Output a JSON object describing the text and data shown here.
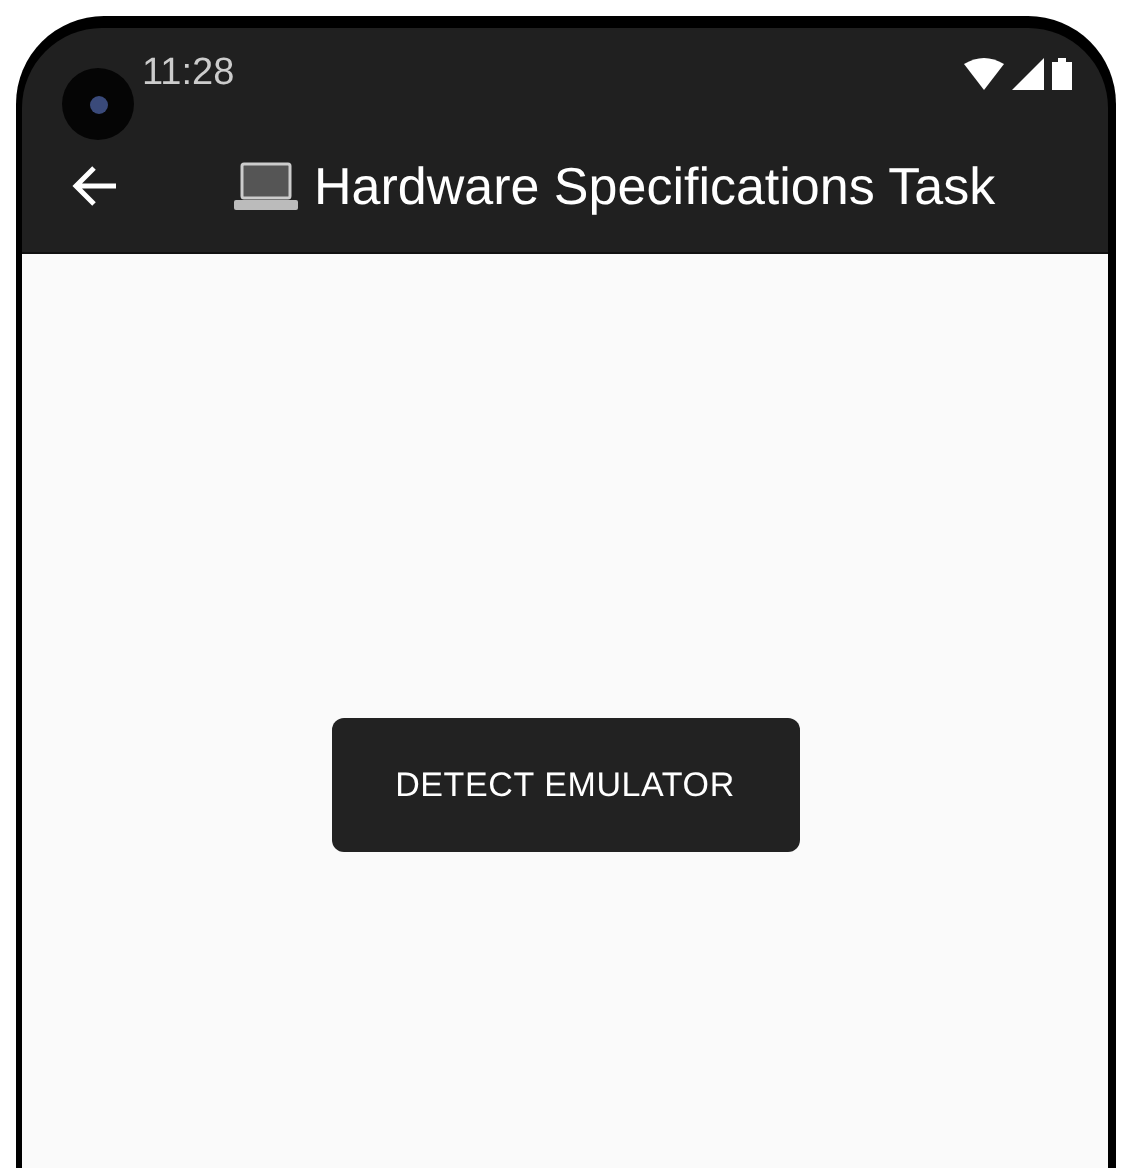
{
  "status_bar": {
    "time": "11:28"
  },
  "app_bar": {
    "title": "Hardware Specifications Task"
  },
  "button": {
    "label": "DETECT EMULATOR"
  }
}
